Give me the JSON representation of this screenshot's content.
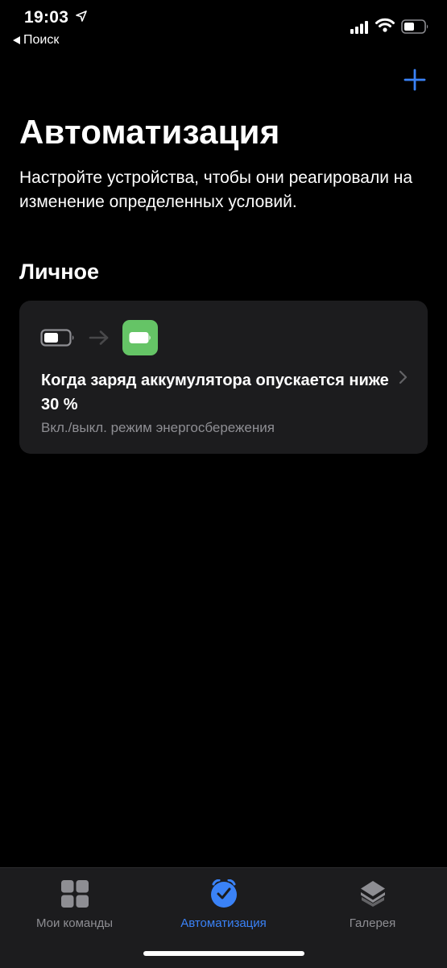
{
  "status_bar": {
    "time": "19:03",
    "back_label": "Поиск"
  },
  "header": {
    "add_icon": "plus-icon",
    "title": "Автоматизация",
    "subtitle": "Настройте устройства, чтобы они реагировали на изменение определенных условий."
  },
  "section": {
    "title": "Личное"
  },
  "automation": {
    "title": "Когда заряд аккумулятора опускается ниже 30 %",
    "subtitle": "Вкл./выкл. режим энергосбережения",
    "icons": [
      "battery-low-icon",
      "arrow-right-icon",
      "battery-green-icon"
    ],
    "tile_color": "#65c466"
  },
  "tab_bar": {
    "tabs": [
      {
        "label": "Мои команды",
        "icon": "grid-icon",
        "active": false
      },
      {
        "label": "Автоматизация",
        "icon": "clock-icon",
        "active": true
      },
      {
        "label": "Галерея",
        "icon": "layers-icon",
        "active": false
      }
    ],
    "active_color": "#3a82f7",
    "inactive_color": "#8e8e93"
  }
}
